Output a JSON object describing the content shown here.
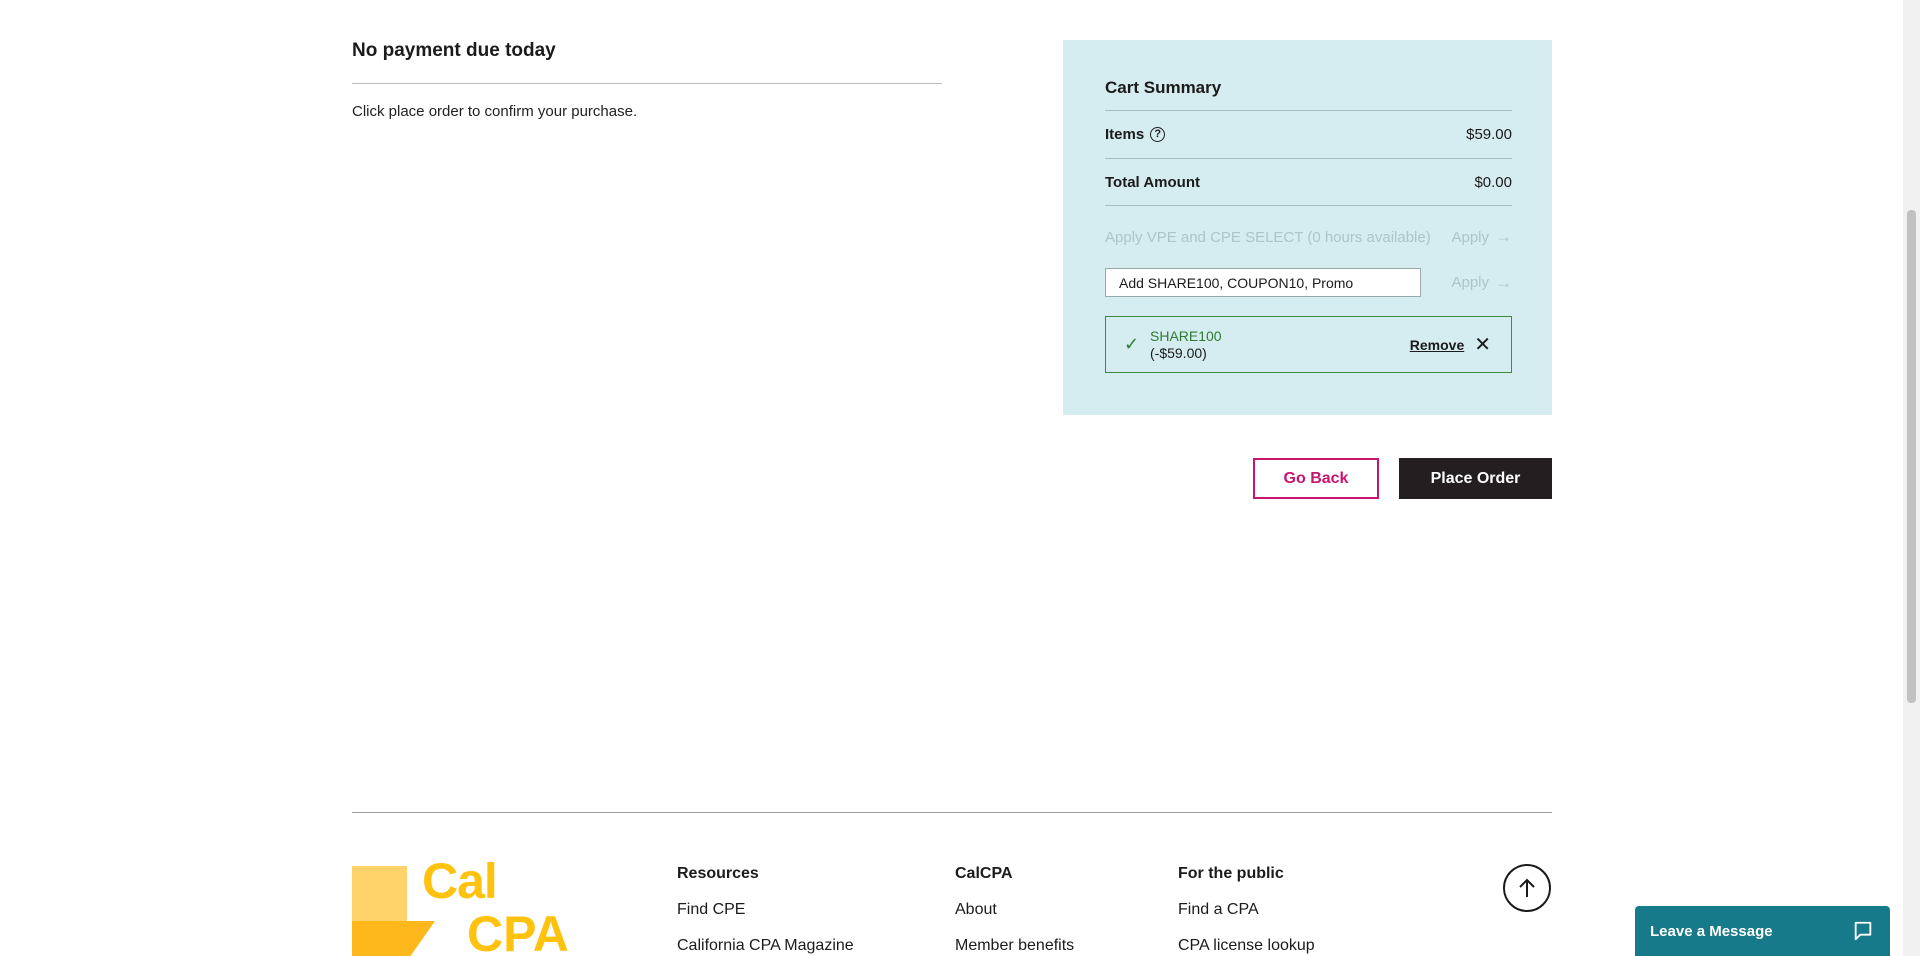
{
  "payment": {
    "heading": "No payment due today",
    "message": "Click place order to confirm your purchase."
  },
  "cart": {
    "title": "Cart Summary",
    "items_label": "Items",
    "items_value": "$59.00",
    "total_label": "Total Amount",
    "total_value": "$0.00",
    "vpe_label": "Apply VPE and CPE SELECT (0 hours available)",
    "apply_label": "Apply",
    "coupon_placeholder": "Add SHARE100, COUPON10, Promo",
    "applied_code": "SHARE100",
    "applied_amount": "(-$59.00)",
    "remove_label": "Remove"
  },
  "actions": {
    "go_back": "Go Back",
    "place_order": "Place Order"
  },
  "footer": {
    "logo_line1": "Cal",
    "logo_line2": "CPA",
    "columns": [
      {
        "heading": "Resources",
        "links": [
          "Find CPE",
          "California CPA Magazine"
        ]
      },
      {
        "heading": "CalCPA",
        "links": [
          "About",
          "Member benefits"
        ]
      },
      {
        "heading": "For the public",
        "links": [
          "Find a CPA",
          "CPA license lookup"
        ]
      }
    ]
  },
  "chat": {
    "label": "Leave a Message"
  },
  "colors": {
    "panel_bg": "#d5ecf1",
    "accent_pink": "#c8166e",
    "primary_dark": "#231f20",
    "success_green": "#2e7d32",
    "logo_yellow": "#ffc20e",
    "chat_teal": "#177a8a"
  },
  "icons": [
    "help-icon",
    "arrow-right-icon",
    "check-icon",
    "close-icon",
    "arrow-up-icon",
    "chat-icon"
  ]
}
